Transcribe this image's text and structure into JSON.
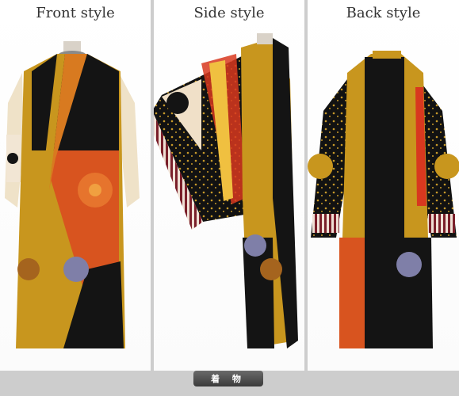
{
  "panels": [
    {
      "title": "Front style"
    },
    {
      "title": "Side style"
    },
    {
      "title": "Back style"
    }
  ],
  "footer": {
    "label": "着 物"
  },
  "colors": {
    "gold": "#c8961e",
    "orange": "#d8541f",
    "black": "#141414",
    "red": "#b4262c"
  }
}
